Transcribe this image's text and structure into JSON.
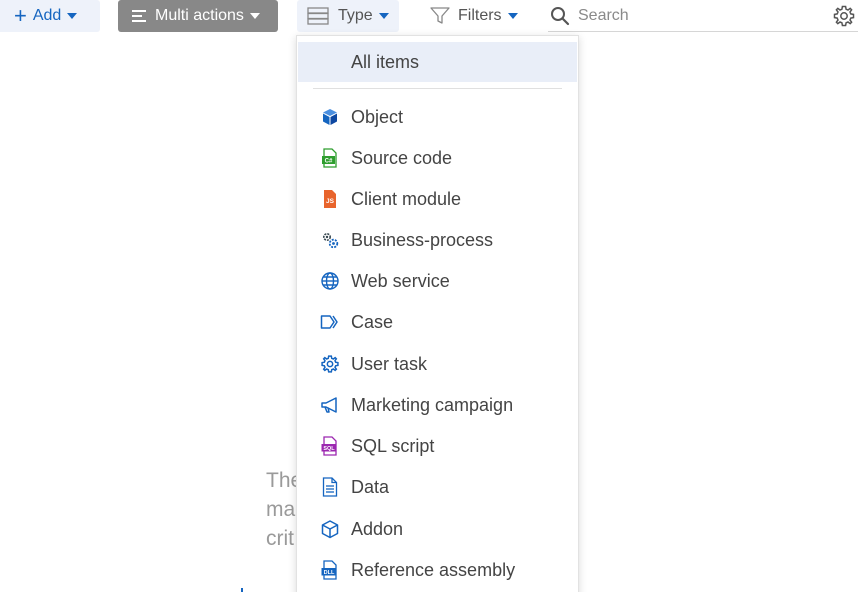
{
  "toolbar": {
    "add_label": "Add",
    "multi_actions_label": "Multi actions",
    "type_label": "Type",
    "filters_label": "Filters",
    "search_placeholder": "Search"
  },
  "type_menu": {
    "all_items": "All items",
    "items": [
      {
        "label": "Object",
        "icon": "cube-icon",
        "color": "#1565c0"
      },
      {
        "label": "Source code",
        "icon": "csharp-file-icon",
        "color": "#2e9e2e"
      },
      {
        "label": "Client module",
        "icon": "js-file-icon",
        "color": "#e8642c"
      },
      {
        "label": "Business-process",
        "icon": "gears-icon",
        "color": "#37474f"
      },
      {
        "label": "Web service",
        "icon": "globe-icon",
        "color": "#1565c0"
      },
      {
        "label": "Case",
        "icon": "case-arrow-icon",
        "color": "#1565c0"
      },
      {
        "label": "User task",
        "icon": "gear-icon",
        "color": "#1565c0"
      },
      {
        "label": "Marketing campaign",
        "icon": "megaphone-icon",
        "color": "#1565c0"
      },
      {
        "label": "SQL script",
        "icon": "sql-file-icon",
        "color": "#9c27b0"
      },
      {
        "label": "Data",
        "icon": "document-icon",
        "color": "#1565c0"
      },
      {
        "label": "Addon",
        "icon": "cube-outline-icon",
        "color": "#1565c0"
      },
      {
        "label": "Reference assembly",
        "icon": "dll-file-icon",
        "color": "#1565c0"
      }
    ]
  },
  "empty_state": {
    "line1": "The",
    "line2": "ma",
    "line3": "crit"
  },
  "colors": {
    "accent": "#1565c0",
    "multi_button_bg": "#888888",
    "selected_bg": "#e9eef8"
  }
}
